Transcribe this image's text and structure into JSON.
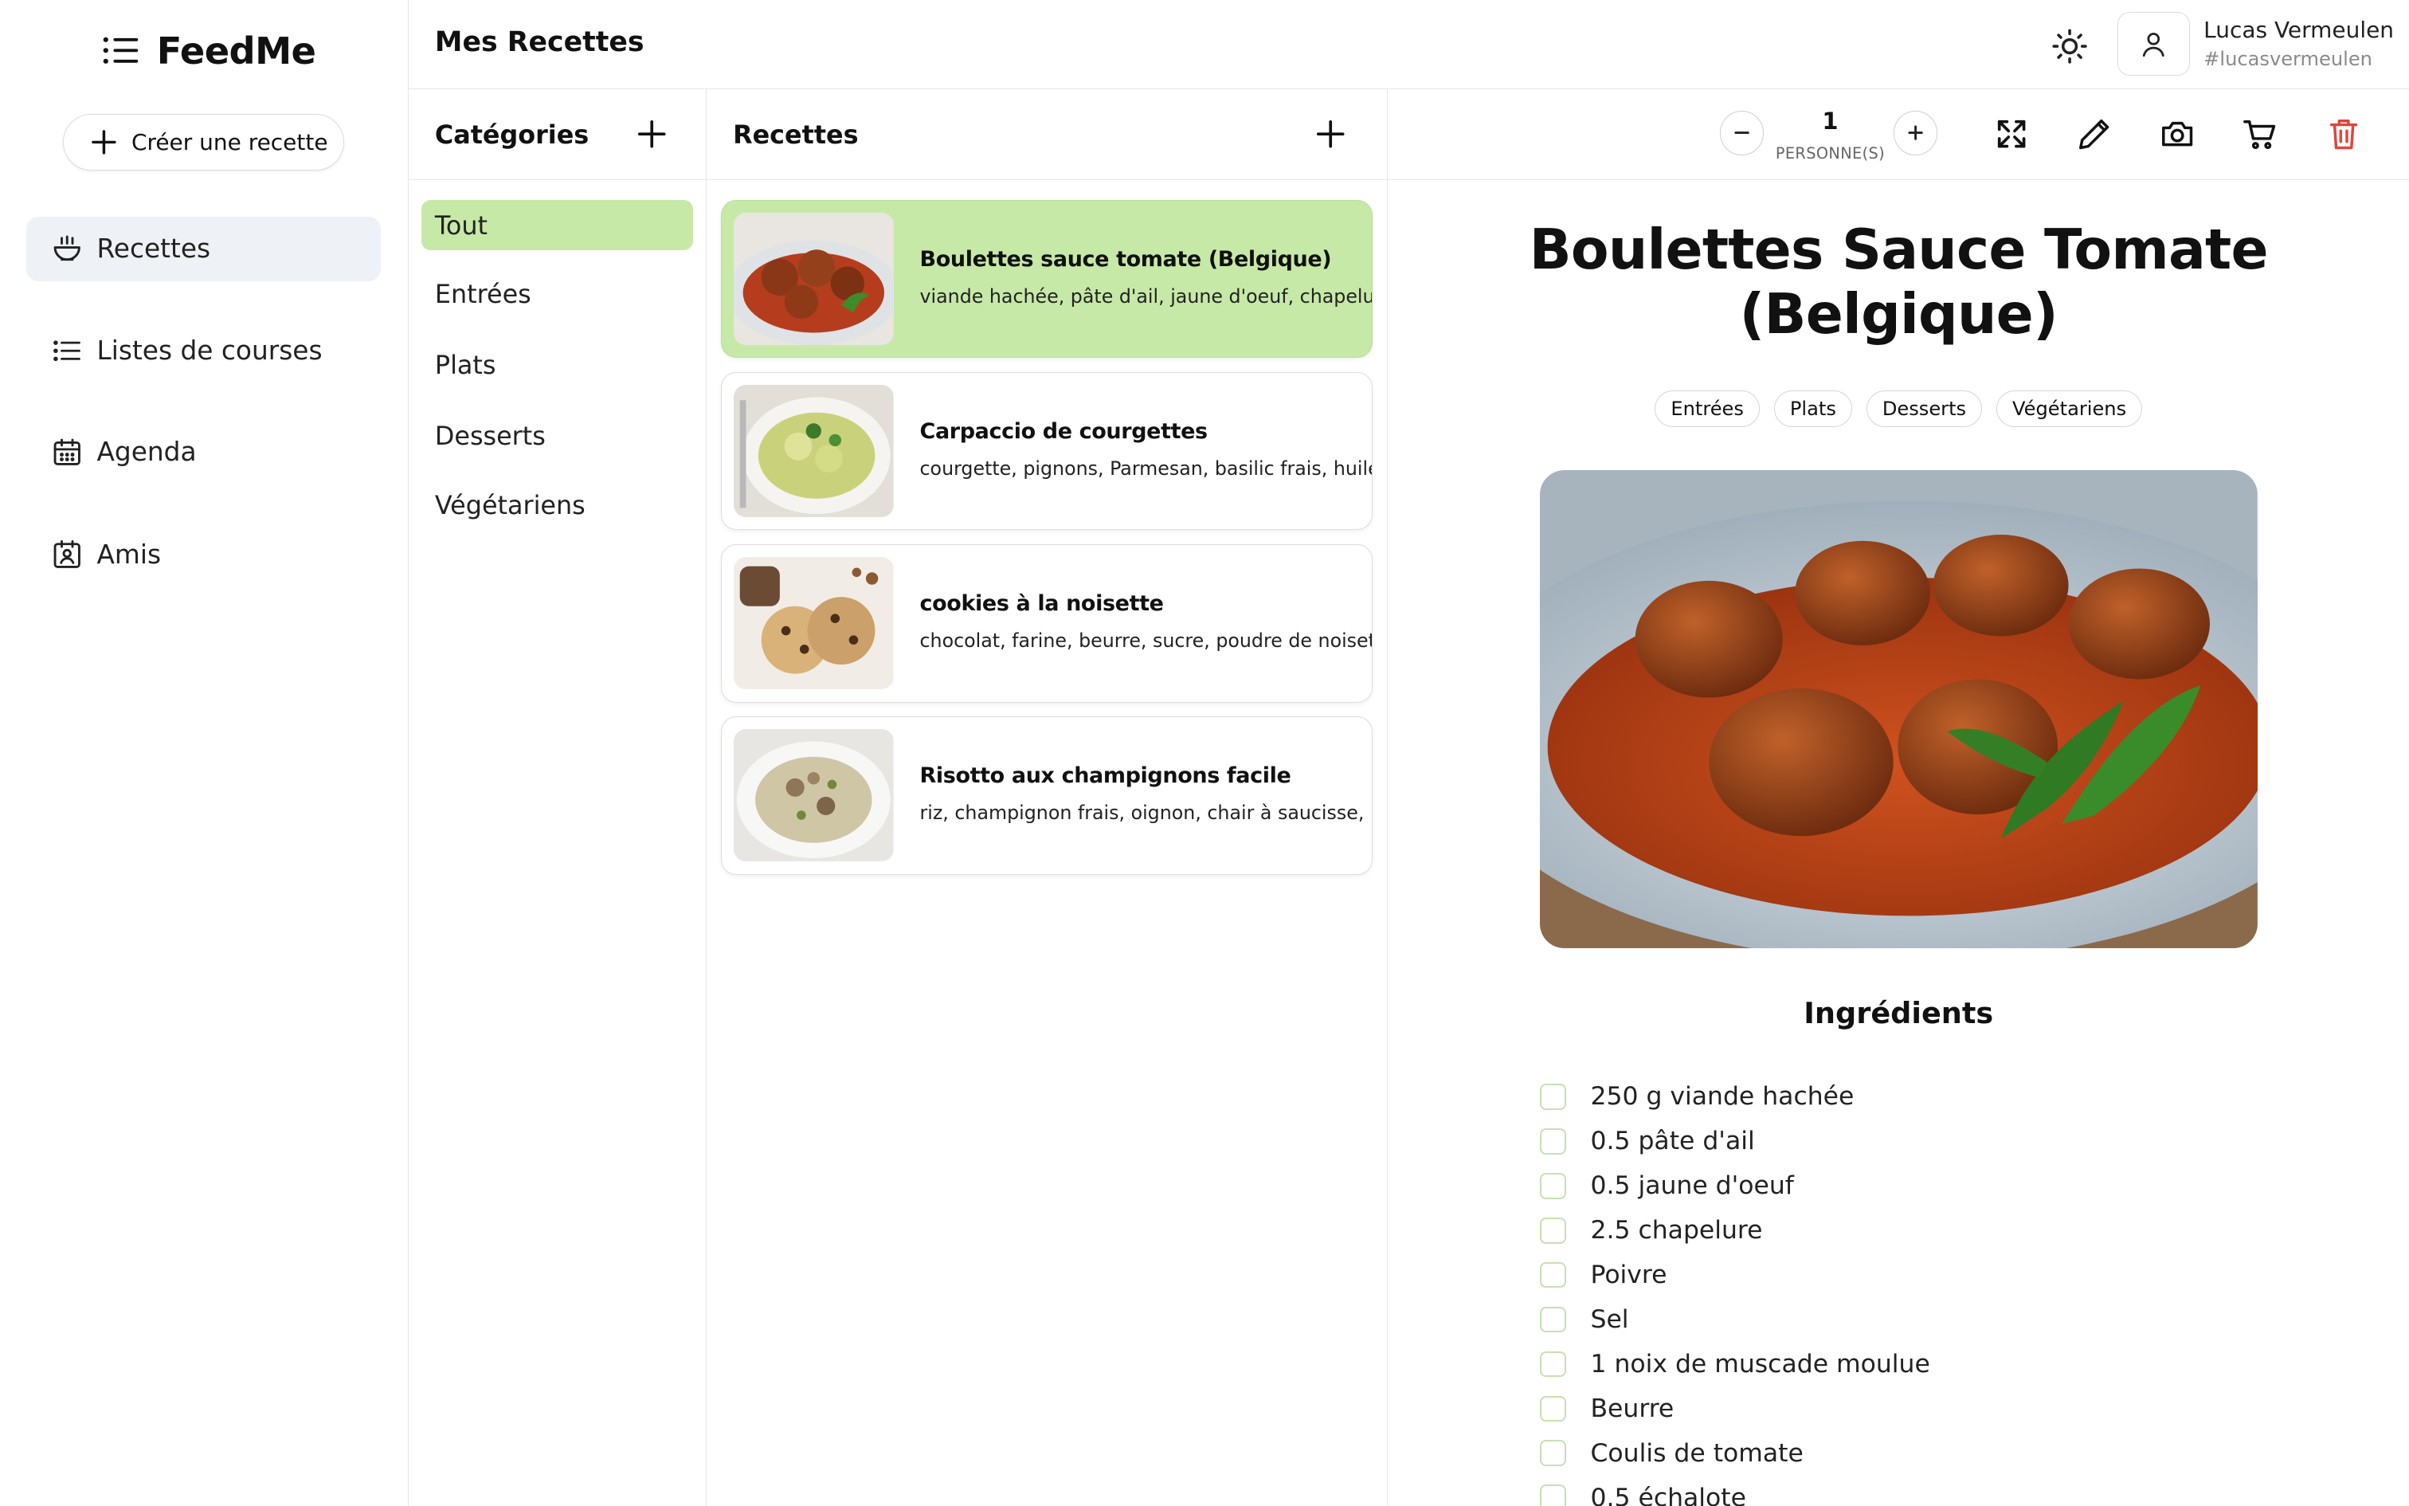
{
  "app": {
    "name": "FeedMe"
  },
  "sidebar": {
    "create_label": "Créer une recette",
    "items": [
      {
        "label": "Recettes",
        "icon": "bowl-icon",
        "active": true
      },
      {
        "label": "Listes de courses",
        "icon": "list-icon"
      },
      {
        "label": "Agenda",
        "icon": "calendar-icon"
      },
      {
        "label": "Amis",
        "icon": "contact-icon"
      }
    ]
  },
  "header": {
    "title": "Mes Recettes",
    "user": {
      "name": "Lucas Vermeulen",
      "handle": "#lucasvermeulen"
    }
  },
  "categories": {
    "title": "Catégories",
    "items": [
      {
        "label": "Tout",
        "active": true
      },
      {
        "label": "Entrées"
      },
      {
        "label": "Plats"
      },
      {
        "label": "Desserts"
      },
      {
        "label": "Végétariens"
      }
    ]
  },
  "recipes": {
    "title": "Recettes",
    "items": [
      {
        "title": "Boulettes sauce tomate (Belgique)",
        "ingredients": "viande hachée, pâte d'ail, jaune d'oeuf, chapelure, poivre, sel, noix de muscade",
        "active": true
      },
      {
        "title": "Carpaccio de courgettes",
        "ingredients": "courgette, pignons, Parmesan, basilic frais, huile d'olive"
      },
      {
        "title": "cookies à la noisette",
        "ingredients": "chocolat, farine, beurre, sucre, poudre de noisette, oeuf"
      },
      {
        "title": "Risotto aux champignons facile",
        "ingredients": "riz, champignon frais, oignon, chair à saucisse, beurre"
      }
    ]
  },
  "detail": {
    "servings": "1",
    "servings_label": "PERSONNE(S)",
    "title": "Boulettes Sauce Tomate (Belgique)",
    "tags": [
      "Entrées",
      "Plats",
      "Desserts",
      "Végétariens"
    ],
    "ingredients_title": "Ingrédients",
    "ingredients": [
      "250 g viande hachée",
      "0.5 pâte d'ail",
      "0.5 jaune d'oeuf",
      "2.5 chapelure",
      "Poivre",
      "Sel",
      "1 noix de muscade moulue",
      "Beurre",
      "Coulis de tomate",
      "0.5 échalote"
    ]
  },
  "colors": {
    "accent": "#c7e9a8",
    "danger": "#e0463c",
    "active_nav": "#eef1f6"
  }
}
